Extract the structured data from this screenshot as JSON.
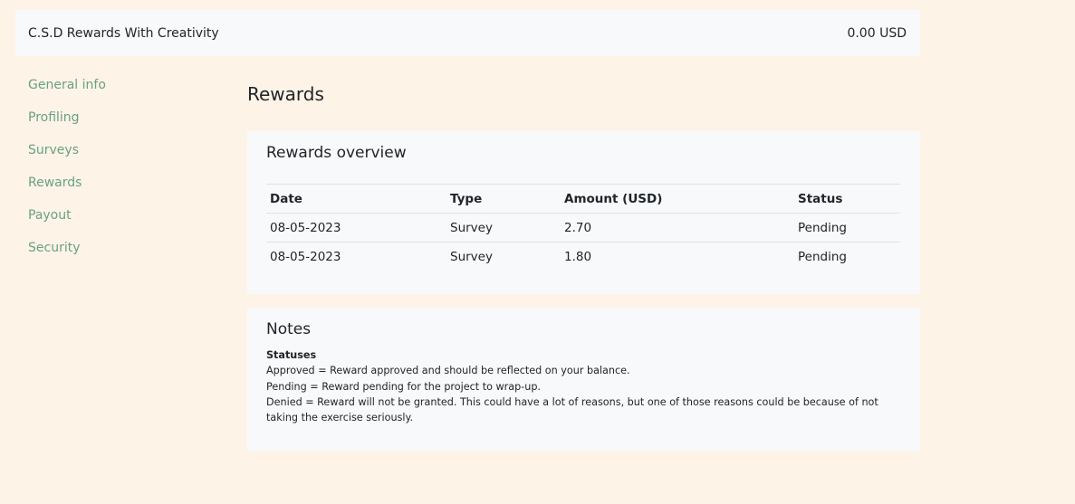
{
  "header": {
    "site_title": "C.S.D Rewards With Creativity",
    "balance": "0.00 USD"
  },
  "sidebar": {
    "items": [
      {
        "label": "General info"
      },
      {
        "label": "Profiling"
      },
      {
        "label": "Surveys"
      },
      {
        "label": "Rewards"
      },
      {
        "label": "Payout"
      },
      {
        "label": "Security"
      }
    ]
  },
  "main": {
    "page_title": "Rewards",
    "overview": {
      "title": "Rewards overview",
      "columns": [
        "Date",
        "Type",
        "Amount (USD)",
        "Status"
      ],
      "rows": [
        [
          "08-05-2023",
          "Survey",
          "2.70",
          "Pending"
        ],
        [
          "08-05-2023",
          "Survey",
          "1.80",
          "Pending"
        ]
      ]
    },
    "notes": {
      "title": "Notes",
      "heading": "Statuses",
      "lines": [
        "Approved = Reward approved and should be reflected on your balance.",
        "Pending = Reward pending for the project to wrap-up.",
        "Denied = Reward will not be granted. This could have a lot of reasons, but one of those reasons could be because of not taking the exercise seriously."
      ]
    }
  },
  "colors": {
    "background": "#fdf3e7",
    "panel": "#f8f9fa",
    "link": "#6aa184"
  }
}
